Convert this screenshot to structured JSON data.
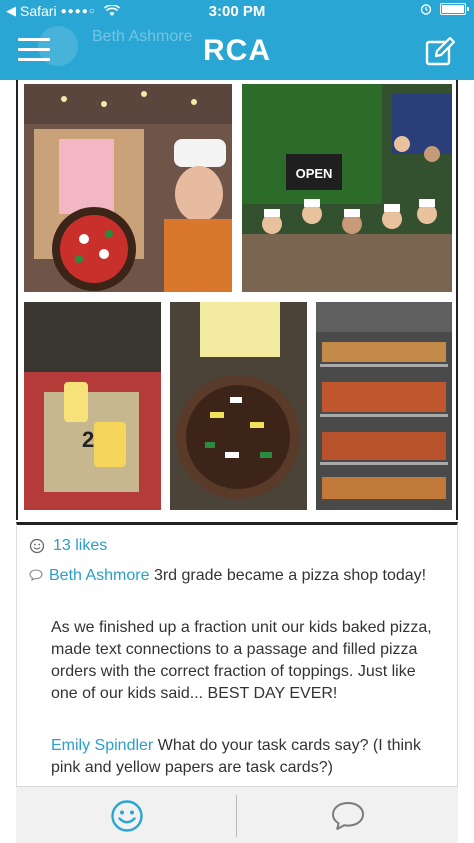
{
  "status_bar": {
    "back_app": "Safari",
    "signal": "●●●●○",
    "time": "3:00 PM"
  },
  "header": {
    "title": "RCA",
    "ghost_name": "Beth Ashmore",
    "menu_icon": "hamburger-menu-icon",
    "edit_icon": "compose-icon"
  },
  "colors": {
    "brand_blue": "#29a6d3",
    "link_blue": "#2a9fcc"
  },
  "photos": [
    {
      "id": "photo-girl-pizza-box"
    },
    {
      "id": "photo-class-group-open-sign"
    },
    {
      "id": "photo-table-candles"
    },
    {
      "id": "photo-paper-pizza"
    },
    {
      "id": "photo-baked-pizza-trays"
    }
  ],
  "post": {
    "likes_count": "13 likes",
    "author": "Beth Ashmore",
    "caption": "3rd grade became a pizza shop today!",
    "body": "As we finished up a fraction unit our kids baked pizza, made text connections to a passage and filled pizza orders with the correct fraction of toppings. Just like one of our kids said... BEST DAY EVER!",
    "reply_author": "Emily Spindler",
    "reply_text": "What do your task cards say? (I think pink and yellow papers are task cards?)"
  },
  "tabbar": {
    "like_icon": "smiley-like-icon",
    "comment_icon": "speech-bubble-icon"
  }
}
